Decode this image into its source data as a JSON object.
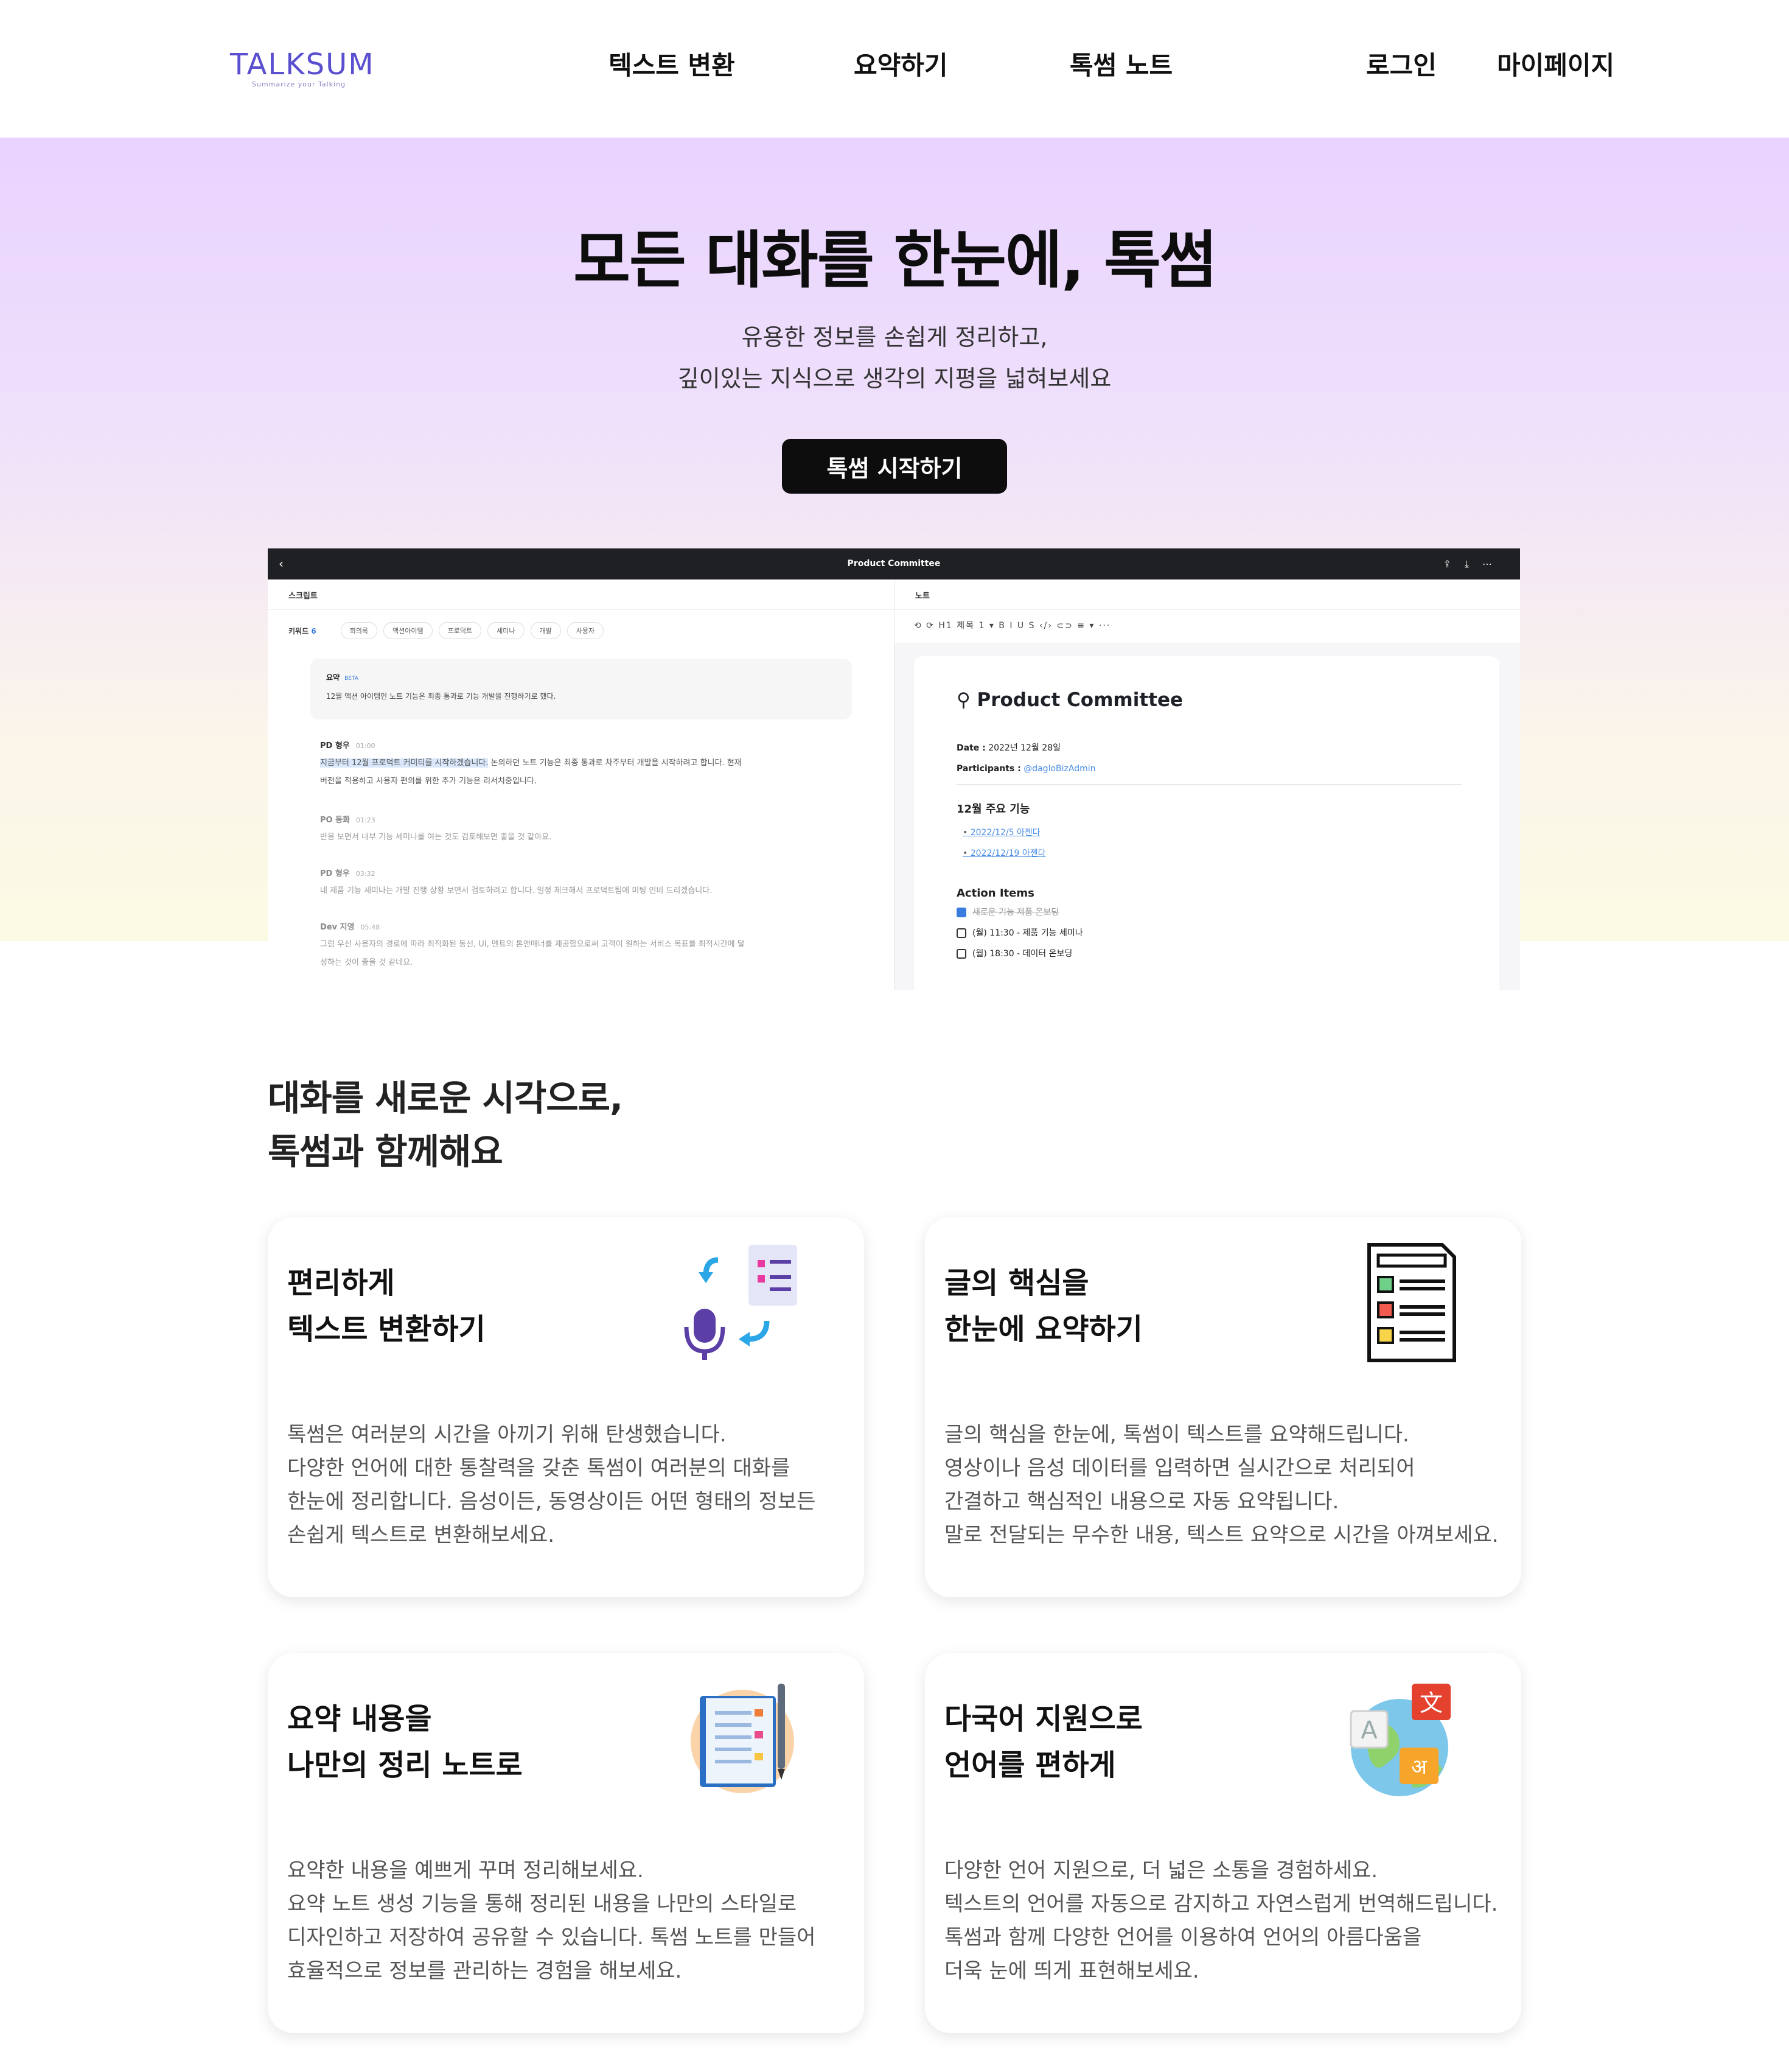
{
  "header": {
    "logo": "TALKSUM",
    "logo_tagline": "Summarize your Talking",
    "nav": {
      "text_convert": "텍스트 변환",
      "summarize": "요약하기",
      "talksum_note": "톡썸 노트",
      "login": "로그인",
      "mypage": "마이페이지"
    }
  },
  "hero": {
    "title": "모든 대화를 한눈에, 톡썸",
    "subtitle_line1": "유용한 정보를 손쉽게 정리하고,",
    "subtitle_line2": "깊이있는 지식으로 생각의 지평을 넓혀보세요",
    "cta": "톡썸 시작하기"
  },
  "mock": {
    "window_title": "Product Committee",
    "left_header": "스크립트",
    "keywords_label": "키워드",
    "keywords_count": "6",
    "keywords": [
      "회의록",
      "액션아이템",
      "프로덕트",
      "세미나",
      "개발",
      "사용자"
    ],
    "summary_label": "요약",
    "summary_badge": "BETA",
    "summary_text": "12월 액션 아이템인 노트 기능은 최종 통과로 기능 개발을 진행하기로 했다.",
    "turns": [
      {
        "speaker": "PD 형우",
        "time": "01:00",
        "highlight": "지금부터 12월 프로덕트 커미티를 시작하겠습니다.",
        "line1": " 논의하던 노트 기능은 최종 통과로 차주부터 개발을 시작하려고 합니다. 현재",
        "line2": "버전을 적용하고 사용자 편의를 위한 추가 기능은 리서치중입니다."
      },
      {
        "speaker": "PO 동화",
        "time": "01:23",
        "line1": "반응 보면서 내부 기능 세미나를 여는 것도 검토해보면 좋을 것 같아요."
      },
      {
        "speaker": "PD 형우",
        "time": "03:32",
        "line1": "네 제품 기능 세미나는 개발 진행 상황 보면서 검토하려고 합니다. 일정 체크해서 프로덕트팀에 미팅 인비 드리겠습니다."
      },
      {
        "speaker": "Dev 지영",
        "time": "05:48",
        "line1": "그럼 우선 사용자의 경로에 따라 최적화된 동선, UI, 멘트의 톤앤매너를 제공함으로써 고객이 원하는 서비스 목표를 최적시간에 달",
        "line2": "성하는 것이 좋을 것 같네요."
      }
    ],
    "right_header": "노트",
    "toolbar": "⟲ ⟳   H1 제목 1   ▾   B  I  U  S  ‹/›  ⊂⊃   ≡ ▾   ···",
    "note_title": "Product Committee",
    "date_label": "Date :",
    "date_value": "2022년 12월 28일",
    "participants_label": "Participants :",
    "participants_value": "@dagloBizAdmin",
    "section1": "12월 주요 기능",
    "links": [
      "2022/12/5 아젠다",
      "2022/12/19 아젠다"
    ],
    "section2": "Action Items",
    "action_items": [
      {
        "text": "새로운 기능 제품 온보딩",
        "done": true
      },
      {
        "text": "(월) 11:30 - 제품 기능 세미나",
        "done": false
      },
      {
        "text": "(월) 18:30 - 데이터 온보딩",
        "done": false
      }
    ]
  },
  "features": {
    "section_title_line1": "대화를 새로운 시각으로,",
    "section_title_line2": "톡썸과 함께해요",
    "cards": [
      {
        "title1": "편리하게",
        "title2": "텍스트 변환하기",
        "icon": "speech-to-text-icon",
        "desc": [
          "톡썸은 여러분의 시간을 아끼기 위해 탄생했습니다.",
          "다양한 언어에 대한 통찰력을 갖춘 톡썸이 여러분의 대화를",
          "한눈에 정리합니다. 음성이든, 동영상이든 어떤 형태의 정보든",
          "손쉽게 텍스트로 변환해보세요."
        ]
      },
      {
        "title1": "글의 핵심을",
        "title2": "한눈에 요약하기",
        "icon": "checklist-document-icon",
        "desc": [
          "글의 핵심을 한눈에, 톡썸이 텍스트를 요약해드립니다.",
          "영상이나 음성 데이터를 입력하면 실시간으로 처리되어",
          "간결하고 핵심적인 내용으로 자동 요약됩니다.",
          "말로 전달되는 무수한 내용, 텍스트 요약으로 시간을 아껴보세요."
        ]
      },
      {
        "title1": "요약 내용을",
        "title2": "나만의 정리 노트로",
        "icon": "notebook-pen-icon",
        "desc": [
          "요약한 내용을 예쁘게 꾸며 정리해보세요.",
          "요약 노트 생성 기능을 통해 정리된 내용을 나만의 스타일로",
          "디자인하고 저장하여 공유할 수 있습니다. 톡썸 노트를 만들어",
          "효율적으로 정보를 관리하는 경험을 해보세요."
        ]
      },
      {
        "title1": "다국어 지원으로",
        "title2": "언어를 편하게",
        "icon": "translate-globe-icon",
        "desc": [
          "다양한 언어 지원으로, 더 넓은 소통을 경험하세요.",
          "텍스트의 언어를 자동으로 감지하고 자연스럽게 번역해드립니다.",
          "톡썸과 함께 다양한 언어를 이용하여 언어의 아름다움을",
          "더욱 눈에 띄게 표현해보세요."
        ]
      }
    ]
  },
  "colors": {
    "brand": "#5a4fcf",
    "hero_top": "#e9d3ff",
    "hero_bottom": "#fbfbe4",
    "cta_bg": "#0d0d0d"
  }
}
